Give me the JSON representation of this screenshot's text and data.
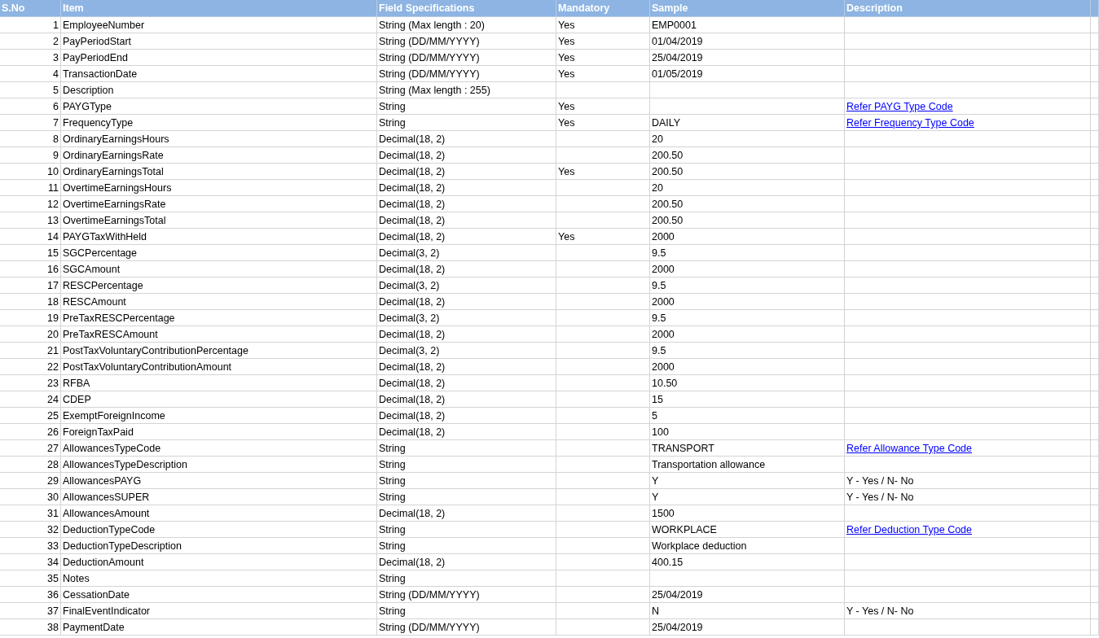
{
  "table": {
    "columns": [
      "S.No",
      "Item",
      "Field Specifications",
      "Mandatory",
      "Sample",
      "Description"
    ],
    "rows": [
      {
        "sno": "1",
        "item": "EmployeeNumber",
        "spec": "String (Max length : 20)",
        "mandatory": "Yes",
        "sample": "EMP0001"
      },
      {
        "sno": "2",
        "item": "PayPeriodStart",
        "spec": "String (DD/MM/YYYY)",
        "mandatory": "Yes",
        "sample": "01/04/2019"
      },
      {
        "sno": "3",
        "item": "PayPeriodEnd",
        "spec": "String (DD/MM/YYYY)",
        "mandatory": "Yes",
        "sample": "25/04/2019"
      },
      {
        "sno": "4",
        "item": "TransactionDate",
        "spec": "String (DD/MM/YYYY)",
        "mandatory": "Yes",
        "sample": "01/05/2019"
      },
      {
        "sno": "5",
        "item": "Description",
        "spec": "String (Max length : 255)"
      },
      {
        "sno": "6",
        "item": "PAYGType",
        "spec": "String",
        "mandatory": "Yes",
        "description": {
          "kind": "link",
          "text": "Refer PAYG Type Code"
        }
      },
      {
        "sno": "7",
        "item": "FrequencyType",
        "spec": "String",
        "mandatory": "Yes",
        "sample": "DAILY",
        "description": {
          "kind": "link",
          "text": "Refer Frequency Type Code"
        }
      },
      {
        "sno": "8",
        "item": "OrdinaryEarningsHours",
        "spec": "Decimal(18, 2)",
        "sample": "20"
      },
      {
        "sno": "9",
        "item": "OrdinaryEarningsRate",
        "spec": "Decimal(18, 2)",
        "sample": "200.50"
      },
      {
        "sno": "10",
        "item": "OrdinaryEarningsTotal",
        "spec": "Decimal(18, 2)",
        "mandatory": "Yes",
        "sample": "200.50"
      },
      {
        "sno": "11",
        "item": "OvertimeEarningsHours",
        "spec": "Decimal(18, 2)",
        "sample": "20"
      },
      {
        "sno": "12",
        "item": "OvertimeEarningsRate",
        "spec": "Decimal(18, 2)",
        "sample": "200.50"
      },
      {
        "sno": "13",
        "item": "OvertimeEarningsTotal",
        "spec": "Decimal(18, 2)",
        "sample": "200.50"
      },
      {
        "sno": "14",
        "item": "PAYGTaxWithHeld",
        "spec": "Decimal(18, 2)",
        "mandatory": "Yes",
        "sample": "2000"
      },
      {
        "sno": "15",
        "item": "SGCPercentage",
        "spec": "Decimal(3, 2)",
        "sample": "9.5"
      },
      {
        "sno": "16",
        "item": "SGCAmount",
        "spec": "Decimal(18, 2)",
        "sample": "2000"
      },
      {
        "sno": "17",
        "item": "RESCPercentage",
        "spec": "Decimal(3, 2)",
        "sample": "9.5"
      },
      {
        "sno": "18",
        "item": "RESCAmount",
        "spec": "Decimal(18, 2)",
        "sample": "2000"
      },
      {
        "sno": "19",
        "item": "PreTaxRESCPercentage",
        "spec": "Decimal(3, 2)",
        "sample": "9.5"
      },
      {
        "sno": "20",
        "item": "PreTaxRESCAmount",
        "spec": "Decimal(18, 2)",
        "sample": "2000"
      },
      {
        "sno": "21",
        "item": "PostTaxVoluntaryContributionPercentage",
        "spec": "Decimal(3, 2)",
        "sample": "9.5"
      },
      {
        "sno": "22",
        "item": "PostTaxVoluntaryContributionAmount",
        "spec": "Decimal(18, 2)",
        "sample": "2000"
      },
      {
        "sno": "23",
        "item": "RFBA",
        "spec": "Decimal(18, 2)",
        "sample": "10.50"
      },
      {
        "sno": "24",
        "item": "CDEP",
        "spec": "Decimal(18, 2)",
        "sample": "15"
      },
      {
        "sno": "25",
        "item": "ExemptForeignIncome",
        "spec": "Decimal(18, 2)",
        "sample": "5"
      },
      {
        "sno": "26",
        "item": "ForeignTaxPaid",
        "spec": "Decimal(18, 2)",
        "sample": "100"
      },
      {
        "sno": "27",
        "item": "AllowancesTypeCode",
        "spec": "String",
        "sample": "TRANSPORT",
        "description": {
          "kind": "link",
          "text": "Refer Allowance Type Code"
        }
      },
      {
        "sno": "28",
        "item": "AllowancesTypeDescription",
        "spec": "String",
        "sample": "Transportation allowance"
      },
      {
        "sno": "29",
        "item": "AllowancesPAYG",
        "spec": "String",
        "sample": "Y",
        "description": {
          "kind": "text",
          "text": "Y - Yes / N- No"
        }
      },
      {
        "sno": "30",
        "item": "AllowancesSUPER",
        "spec": "String",
        "sample": "Y",
        "description": {
          "kind": "text",
          "text": "Y - Yes / N- No"
        }
      },
      {
        "sno": "31",
        "item": "AllowancesAmount",
        "spec": "Decimal(18, 2)",
        "sample": "1500"
      },
      {
        "sno": "32",
        "item": "DeductionTypeCode",
        "spec": "String",
        "sample": "WORKPLACE",
        "description": {
          "kind": "link",
          "text": "Refer Deduction Type Code"
        }
      },
      {
        "sno": "33",
        "item": "DeductionTypeDescription",
        "spec": "String",
        "sample": "Workplace deduction"
      },
      {
        "sno": "34",
        "item": "DeductionAmount",
        "spec": "Decimal(18, 2)",
        "sample": "400.15"
      },
      {
        "sno": "35",
        "item": "Notes",
        "spec": "String"
      },
      {
        "sno": "36",
        "item": "CessationDate",
        "spec": "String (DD/MM/YYYY)",
        "sample": "25/04/2019"
      },
      {
        "sno": "37",
        "item": "FinalEventIndicator",
        "spec": "String",
        "sample": "N",
        "description": {
          "kind": "text",
          "text": "Y - Yes / N- No"
        }
      },
      {
        "sno": "38",
        "item": "PaymentDate",
        "spec": "String (DD/MM/YYYY)",
        "sample": "25/04/2019"
      }
    ]
  }
}
